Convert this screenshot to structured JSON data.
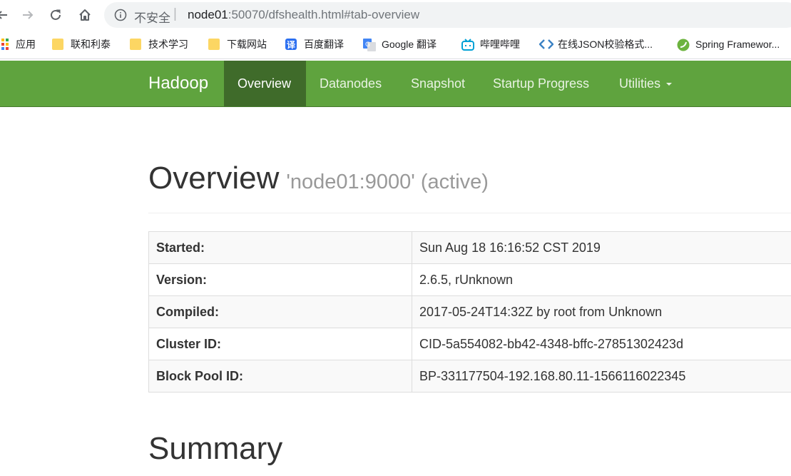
{
  "browser": {
    "security_label": "不安全",
    "separator": "|",
    "url_host": "node01",
    "url_rest": ":50070/dfshealth.html#tab-overview",
    "nav_buttons": [
      "back-icon",
      "forward-icon",
      "reload-icon",
      "home-icon"
    ],
    "bookmarks": [
      {
        "label": "应用",
        "icon": "apps-grid-icon"
      },
      {
        "label": "联和利泰",
        "icon": "folder-icon"
      },
      {
        "label": "技术学习",
        "icon": "folder-icon"
      },
      {
        "label": "下载网站",
        "icon": "folder-icon"
      },
      {
        "label": "百度翻译",
        "icon": "baidu-translate-icon",
        "glyph": "译"
      },
      {
        "label": "Google 翻译",
        "icon": "google-translate-icon"
      },
      {
        "label": "哔哩哔哩",
        "icon": "bilibili-icon"
      },
      {
        "label": "在线JSON校验格式...",
        "icon": "json-icon"
      },
      {
        "label": "Spring Framewor...",
        "icon": "spring-icon"
      }
    ]
  },
  "navbar": {
    "brand": "Hadoop",
    "items": [
      {
        "label": "Overview",
        "active": true
      },
      {
        "label": "Datanodes",
        "active": false
      },
      {
        "label": "Snapshot",
        "active": false
      },
      {
        "label": "Startup Progress",
        "active": false
      },
      {
        "label": "Utilities",
        "active": false,
        "dropdown": true
      }
    ],
    "colors": {
      "bar": "#5fa33e",
      "active": "#3f6b2a"
    }
  },
  "overview": {
    "title": "Overview",
    "subtitle": "'node01:9000' (active)",
    "rows": [
      {
        "label": "Started:",
        "value": "Sun Aug 18 16:16:52 CST 2019"
      },
      {
        "label": "Version:",
        "value": "2.6.5, rUnknown"
      },
      {
        "label": "Compiled:",
        "value": "2017-05-24T14:32Z by root from Unknown"
      },
      {
        "label": "Cluster ID:",
        "value": "CID-5a554082-bb42-4348-bffc-27851302423d"
      },
      {
        "label": "Block Pool ID:",
        "value": "BP-331177504-192.168.80.11-1566116022345"
      }
    ]
  },
  "summary": {
    "title": "Summary"
  }
}
